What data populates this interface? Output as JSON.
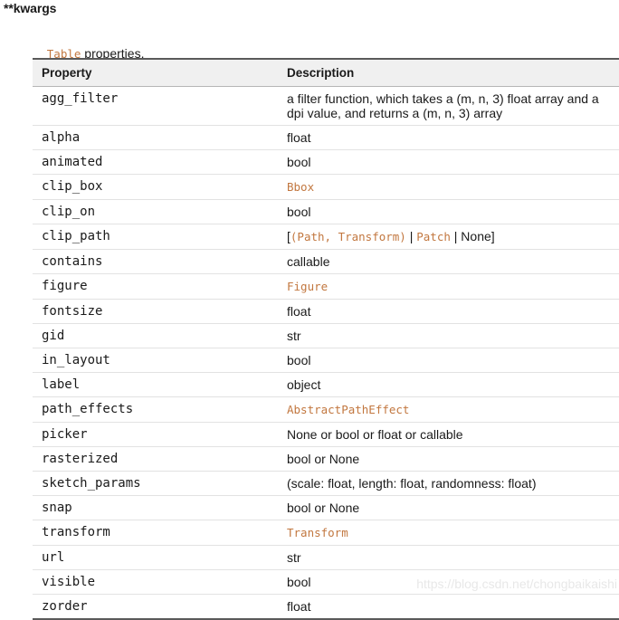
{
  "heading": "**kwargs",
  "intro": {
    "code": "Table",
    "text": " properties."
  },
  "table": {
    "columns": [
      "Property",
      "Description"
    ],
    "rows": [
      {
        "property": "agg_filter",
        "description": "a filter function, which takes a (m, n, 3) float array and a dpi value, and returns a (m, n, 3) array",
        "segments": [
          {
            "kind": "text",
            "value": "a filter function, which takes a (m, n, 3) float array and a dpi value, and returns a (m, n, 3) array"
          }
        ]
      },
      {
        "property": "alpha",
        "description": "float",
        "segments": [
          {
            "kind": "text",
            "value": "float"
          }
        ]
      },
      {
        "property": "animated",
        "description": "bool",
        "segments": [
          {
            "kind": "text",
            "value": "bool"
          }
        ]
      },
      {
        "property": "clip_box",
        "description": "Bbox",
        "segments": [
          {
            "kind": "code",
            "value": "Bbox"
          }
        ]
      },
      {
        "property": "clip_on",
        "description": "bool",
        "segments": [
          {
            "kind": "text",
            "value": "bool"
          }
        ]
      },
      {
        "property": "clip_path",
        "description": "[(Path, Transform) | Patch | None]",
        "segments": [
          {
            "kind": "text",
            "value": "["
          },
          {
            "kind": "code",
            "value": "(Path, Transform)"
          },
          {
            "kind": "text",
            "value": " | "
          },
          {
            "kind": "code",
            "value": "Patch"
          },
          {
            "kind": "text",
            "value": " | None]"
          }
        ]
      },
      {
        "property": "contains",
        "description": "callable",
        "segments": [
          {
            "kind": "text",
            "value": "callable"
          }
        ]
      },
      {
        "property": "figure",
        "description": "Figure",
        "segments": [
          {
            "kind": "code",
            "value": "Figure"
          }
        ]
      },
      {
        "property": "fontsize",
        "description": "float",
        "segments": [
          {
            "kind": "text",
            "value": "float"
          }
        ]
      },
      {
        "property": "gid",
        "description": "str",
        "segments": [
          {
            "kind": "text",
            "value": "str"
          }
        ]
      },
      {
        "property": "in_layout",
        "description": "bool",
        "segments": [
          {
            "kind": "text",
            "value": "bool"
          }
        ]
      },
      {
        "property": "label",
        "description": "object",
        "segments": [
          {
            "kind": "text",
            "value": "object"
          }
        ]
      },
      {
        "property": "path_effects",
        "description": "AbstractPathEffect",
        "segments": [
          {
            "kind": "code",
            "value": "AbstractPathEffect"
          }
        ]
      },
      {
        "property": "picker",
        "description": "None or bool or float or callable",
        "segments": [
          {
            "kind": "text",
            "value": "None or bool or float or callable"
          }
        ]
      },
      {
        "property": "rasterized",
        "description": "bool or None",
        "segments": [
          {
            "kind": "text",
            "value": "bool or None"
          }
        ]
      },
      {
        "property": "sketch_params",
        "description": "(scale: float, length: float, randomness: float)",
        "segments": [
          {
            "kind": "text",
            "value": "(scale: float, length: float, randomness: float)"
          }
        ]
      },
      {
        "property": "snap",
        "description": "bool or None",
        "segments": [
          {
            "kind": "text",
            "value": "bool or None"
          }
        ]
      },
      {
        "property": "transform",
        "description": "Transform",
        "segments": [
          {
            "kind": "code",
            "value": "Transform"
          }
        ]
      },
      {
        "property": "url",
        "description": "str",
        "segments": [
          {
            "kind": "text",
            "value": "str"
          }
        ]
      },
      {
        "property": "visible",
        "description": "bool",
        "segments": [
          {
            "kind": "text",
            "value": "bool"
          }
        ]
      },
      {
        "property": "zorder",
        "description": "float",
        "segments": [
          {
            "kind": "text",
            "value": "float"
          }
        ]
      }
    ]
  },
  "watermark": "https://blog.csdn.net/chongbaikaishi",
  "colors": {
    "code_orange": "#c2773f",
    "text_black": "#1a1a1a",
    "header_bg": "#f0f0f0",
    "rule_strong": "#5a5a5a",
    "rule_light": "#e2e2e2",
    "watermark": "#e8e8e8"
  }
}
